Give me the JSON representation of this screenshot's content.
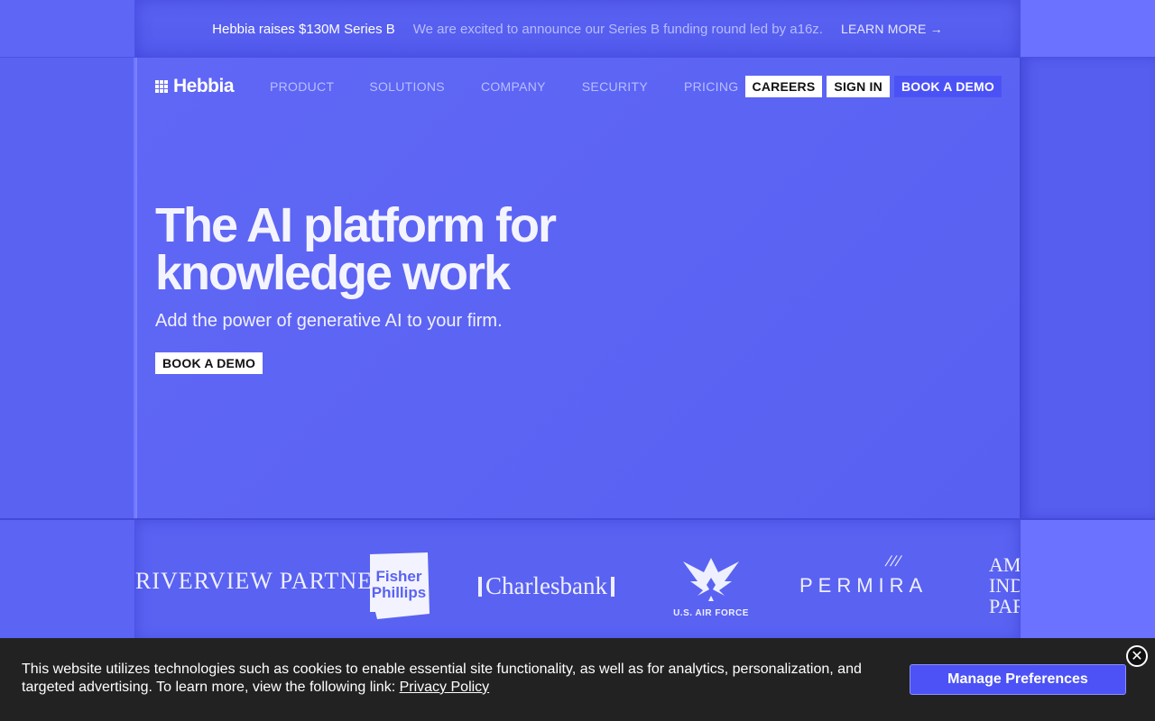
{
  "banner": {
    "title": "Hebbia raises $130M Series B",
    "text": "We are excited to announce our Series B funding round led by a16z.",
    "link": "LEARN MORE →"
  },
  "nav": {
    "logo_text": "Hebbia",
    "links": [
      "PRODUCT",
      "SOLUTIONS",
      "COMPANY",
      "SECURITY",
      "PRICING"
    ],
    "careers": "CAREERS",
    "sign_in": "SIGN IN",
    "book_demo": "BOOK A DEMO"
  },
  "hero": {
    "headline": "The AI platform for knowledge work",
    "subhead": "Add the power of generative AI to your firm.",
    "cta": "BOOK A DEMO"
  },
  "logos": {
    "riverview": "RIVERVIEW PARTNERS",
    "fisher_line1": "Fisher",
    "fisher_line2": "Phillips",
    "charlesbank": "Charlesbank",
    "airforce": "U.S. AIR FORCE",
    "permira": "PERMIRA",
    "permira_mark": "///",
    "ameri_line1": "AMI",
    "ameri_line2": "IND",
    "ameri_line3": "PAR"
  },
  "cookie": {
    "text": "This website utilizes technologies such as cookies to enable essential site functionality, as well as for analytics, personalization, and targeted advertising. To learn more, view the following link:",
    "link": "Privacy Policy",
    "manage": "Manage Preferences",
    "close": "✕"
  }
}
